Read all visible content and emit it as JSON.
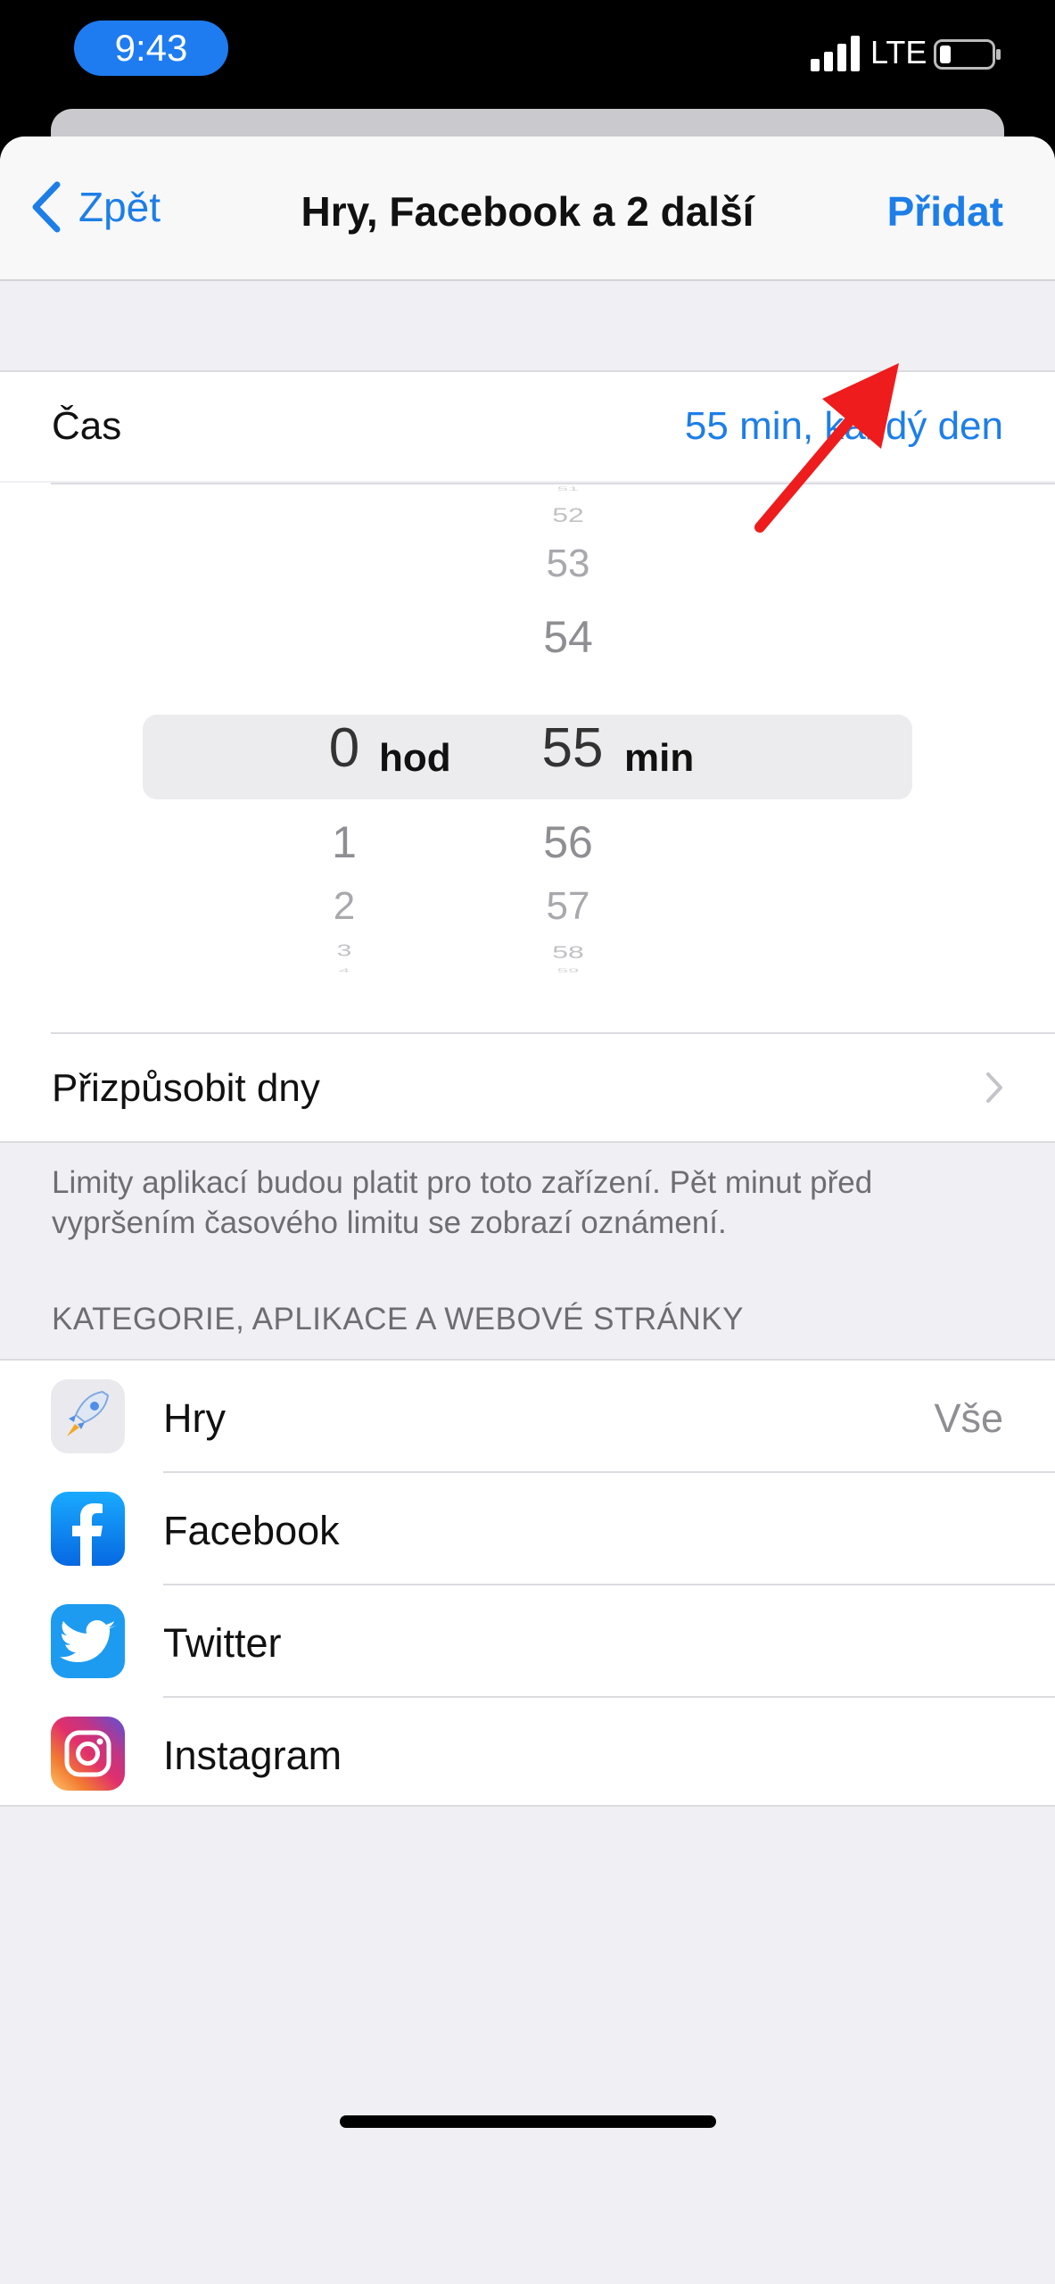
{
  "status_bar": {
    "time": "9:43",
    "network": "LTE"
  },
  "nav": {
    "back_label": "Zpět",
    "title": "Hry, Facebook a 2 další",
    "add_label": "Přidat"
  },
  "time_row": {
    "label": "Čas",
    "value": "55 min, každý den"
  },
  "picker": {
    "hours": {
      "above": [],
      "selected": "0",
      "below": [
        "1",
        "2",
        "3",
        "4"
      ],
      "unit": "hod"
    },
    "minutes": {
      "above": [
        "51",
        "52",
        "53",
        "54"
      ],
      "selected": "55",
      "below": [
        "56",
        "57",
        "58",
        "59"
      ],
      "unit": "min"
    }
  },
  "customize_days": {
    "label": "Přizpůsobit dny"
  },
  "footnote": "Limity aplikací budou platit pro toto zařízení. Pět minut před vypršením časového limitu se zobrazí oznámení.",
  "section_header": "KATEGORIE, APLIKACE A WEBOVÉ STRÁNKY",
  "apps": [
    {
      "name": "Hry",
      "detail": "Vše",
      "icon": "rocket-icon"
    },
    {
      "name": "Facebook",
      "detail": "",
      "icon": "facebook-icon"
    },
    {
      "name": "Twitter",
      "detail": "",
      "icon": "twitter-icon"
    },
    {
      "name": "Instagram",
      "detail": "",
      "icon": "instagram-icon"
    }
  ],
  "colors": {
    "accent": "#1d7ee8",
    "annotation_arrow": "#ee1c1c"
  }
}
